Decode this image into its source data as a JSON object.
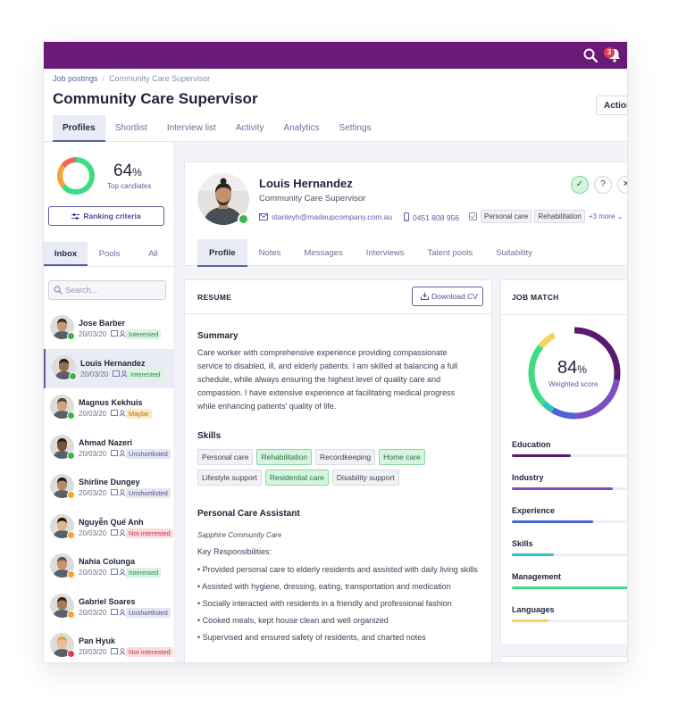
{
  "topbar": {
    "notification_count": "3",
    "brand_color": "#6a1b7a"
  },
  "breadcrumb": {
    "root": "Job postings",
    "current": "Community Care Supervisor"
  },
  "page": {
    "title": "Community Care Supervisor",
    "actions_label": "Actions"
  },
  "tabs": [
    "Profiles",
    "Shortlist",
    "Interview list",
    "Activity",
    "Analytics",
    "Settings"
  ],
  "sidebar": {
    "score": "64",
    "score_unit": "%",
    "score_caption": "Top candiates",
    "ranking_label": "Ranking criteria",
    "tabs": [
      "Inbox",
      "Pools",
      "All"
    ],
    "search_placeholder": "Search...",
    "candidates": [
      {
        "name": "Jose Barber",
        "date": "20/03/20",
        "status": "Interested",
        "status_type": "interested",
        "online": "#39b54a"
      },
      {
        "name": "Louis Hernandez",
        "date": "20/03/20",
        "status": "Interested",
        "status_type": "interested",
        "online": "#39b54a"
      },
      {
        "name": "Magnus Kekhuis",
        "date": "20/03/20",
        "status": "Maybe",
        "status_type": "maybe",
        "online": "#39b54a"
      },
      {
        "name": "Ahmad Nazeri",
        "date": "20/03/20",
        "status": "Unshortlisted",
        "status_type": "unshortlisted",
        "online": "#39b54a"
      },
      {
        "name": "Shirline Dungey",
        "date": "20/03/20",
        "status": "Unshortlisted",
        "status_type": "unshortlisted",
        "online": "#f5a623"
      },
      {
        "name": "Nguyễn Quế Anh",
        "date": "20/03/20",
        "status": "Not interested",
        "status_type": "not",
        "online": "#f5a623"
      },
      {
        "name": "Nahia Colunga",
        "date": "20/03/20",
        "status": "Interested",
        "status_type": "interested",
        "online": "#f5a623"
      },
      {
        "name": "Gabriel Soares",
        "date": "20/03/20",
        "status": "Unshortlisted",
        "status_type": "unshortlisted",
        "online": "#f5a623"
      },
      {
        "name": "Pan Hyuk",
        "date": "20/03/20",
        "status": "Not interested",
        "status_type": "not",
        "online": "#e53950"
      }
    ]
  },
  "profile": {
    "name": "Louis Hernandez",
    "role": "Community Care Supervisor",
    "email": "stanleyh@madeupcompany.com.au",
    "phone": "0451 808 956",
    "tags": [
      "Personal care",
      "Rehabilitation"
    ],
    "more": "+3 more",
    "tabs": [
      "Profile",
      "Notes",
      "Messages",
      "Interviews",
      "Talent pools",
      "Suitability"
    ]
  },
  "resume": {
    "title": "RESUME",
    "download_label": "Download CV",
    "summary_heading": "Summary",
    "summary": "Care worker with comprehensive experience providing compassionate service to disabled, ill, and elderly patients. I am skilled at balancing a full schedule, while always ensuring the highest level of quality care and compassion. I have extensive experience at facilitating medical progress while enhancing patients' quality of life.",
    "skills_heading": "Skills",
    "skills": [
      {
        "label": "Personal care",
        "matched": false
      },
      {
        "label": "Rehabilitation",
        "matched": true
      },
      {
        "label": "Recordkeeping",
        "matched": false
      },
      {
        "label": "Home care",
        "matched": true
      },
      {
        "label": "Lifestyle support",
        "matched": false
      },
      {
        "label": "Residential care",
        "matched": true
      },
      {
        "label": "Disability support",
        "matched": false
      }
    ],
    "job_title": "Personal Care Assistant",
    "company": "Sapphire Community Care",
    "responsibilities_label": "Key Responsibilities:",
    "responsibilities": [
      "• Provided personal care to elderly residents and assisted with daily living skills",
      "• Assisted with hygiene, dressing, eating, transportation and medication",
      "• Socially interacted with residents in a friendly and professional fashion",
      "• Cooked meals, kept house clean and well organized",
      "• Supervised and ensured safety of residents, and charted notes"
    ]
  },
  "job_match": {
    "title": "JOB MATCH",
    "score": "84",
    "score_unit": "%",
    "score_caption": "Weighted score",
    "metrics": [
      {
        "label": "Education",
        "value": 0.48,
        "color": "#5a1a6e"
      },
      {
        "label": "Industry",
        "value": 0.82,
        "color": "#7b4fc4"
      },
      {
        "label": "Experience",
        "value": 0.66,
        "color": "#4f63d6"
      },
      {
        "label": "Skills",
        "value": 0.34,
        "color": "#2bc4c0"
      },
      {
        "label": "Management",
        "value": 0.95,
        "color": "#3ddc84"
      },
      {
        "label": "Languages",
        "value": 0.3,
        "color": "#f4d35e"
      }
    ]
  }
}
